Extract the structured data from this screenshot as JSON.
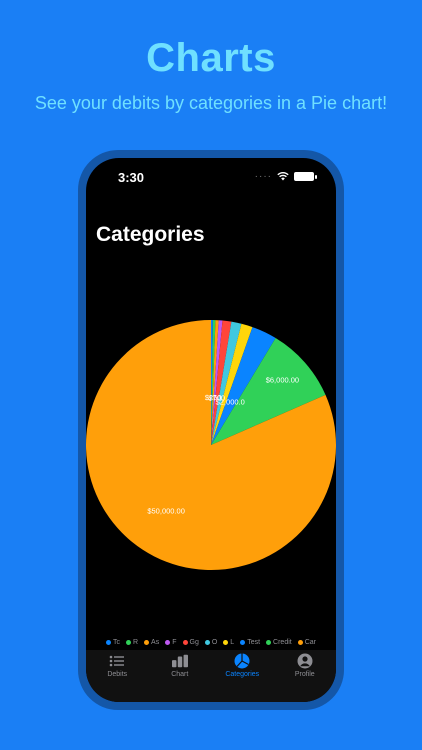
{
  "promo": {
    "headline": "Charts",
    "subline": "See your debits by categories in a Pie chart!"
  },
  "status_bar": {
    "time": "3:30"
  },
  "page": {
    "title": "Categories"
  },
  "chart_data": {
    "type": "pie",
    "slices": [
      {
        "label": "Tc",
        "value": 150,
        "color": "#0a84ff"
      },
      {
        "label": "R",
        "value": 200,
        "color": "#30d158"
      },
      {
        "label": "As",
        "value": 250,
        "color": "#ff9f0a"
      },
      {
        "label": "F",
        "value": 300,
        "color": "#bf5af2"
      },
      {
        "label": "Gg",
        "value": 700,
        "color": "#ff453a"
      },
      {
        "label": "O",
        "value": 800,
        "color": "#40c8e0"
      },
      {
        "label": "L",
        "value": 900,
        "color": "#ffd60a"
      },
      {
        "label": "Test",
        "value": 2000,
        "color": "#0a84ff"
      },
      {
        "label": "Credit",
        "value": 6000,
        "color": "#30d158"
      },
      {
        "label": "Car",
        "value": 50000,
        "color": "#ff9f0a"
      }
    ],
    "value_labels": [
      {
        "slice": 9,
        "text": "$50,000.00"
      },
      {
        "slice": 8,
        "text": "$6,000.00"
      },
      {
        "slice": 7,
        "text": "$2,000.0"
      },
      {
        "slice": 4,
        "text": "$700"
      },
      {
        "slice": 2,
        "text": "$250"
      }
    ]
  },
  "tabs": [
    {
      "label": "Debits",
      "icon": "list-icon",
      "active": false
    },
    {
      "label": "Chart",
      "icon": "bar-chart-icon",
      "active": false
    },
    {
      "label": "Categories",
      "icon": "pie-chart-icon",
      "active": true
    },
    {
      "label": "Profile",
      "icon": "person-circle-icon",
      "active": false
    }
  ]
}
